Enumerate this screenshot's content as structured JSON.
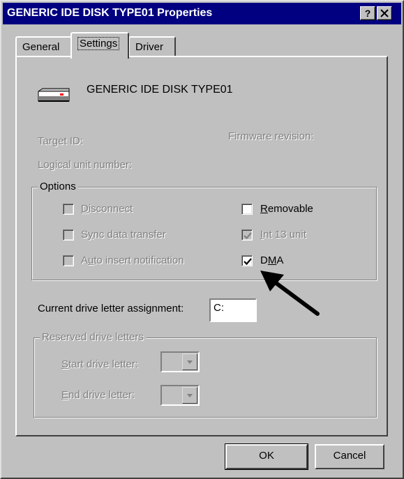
{
  "window": {
    "title": "GENERIC IDE  DISK TYPE01 Properties",
    "help_label": "?",
    "close_label": "✕"
  },
  "tabs": [
    {
      "label": "General",
      "active": false
    },
    {
      "label": "Settings",
      "active": true
    },
    {
      "label": "Driver",
      "active": false
    }
  ],
  "device": {
    "name": "GENERIC IDE  DISK TYPE01",
    "icon": "disk-drive-icon"
  },
  "info": {
    "target_id_label": "Target ID:",
    "firmware_label": "Firmware revision:",
    "logical_unit_label": "Logical unit number:"
  },
  "options": {
    "legend": "Options",
    "disconnect": {
      "label": "Disconnect",
      "checked": false,
      "enabled": false
    },
    "sync": {
      "label": "Sync data transfer",
      "checked": false,
      "enabled": false
    },
    "auto_insert": {
      "label": "Auto insert notification",
      "checked": false,
      "enabled": false
    },
    "removable": {
      "label": "Removable",
      "checked": false,
      "enabled": true
    },
    "int13": {
      "label": "Int 13 unit",
      "checked": true,
      "enabled": false
    },
    "dma": {
      "label": "DMA",
      "checked": true,
      "enabled": true
    }
  },
  "drive_letter": {
    "label": "Current drive letter assignment:",
    "value": "C:"
  },
  "reserved": {
    "legend": "Reserved drive letters",
    "start_label": "Start drive letter:",
    "end_label": "End drive letter:",
    "start_value": "",
    "end_value": ""
  },
  "buttons": {
    "ok": "OK",
    "cancel": "Cancel"
  },
  "annotation": {
    "arrow": "pointer-arrow-icon"
  },
  "colors": {
    "title_bar": "#000080",
    "face": "#c0c0c0",
    "disabled_text": "#808080"
  }
}
